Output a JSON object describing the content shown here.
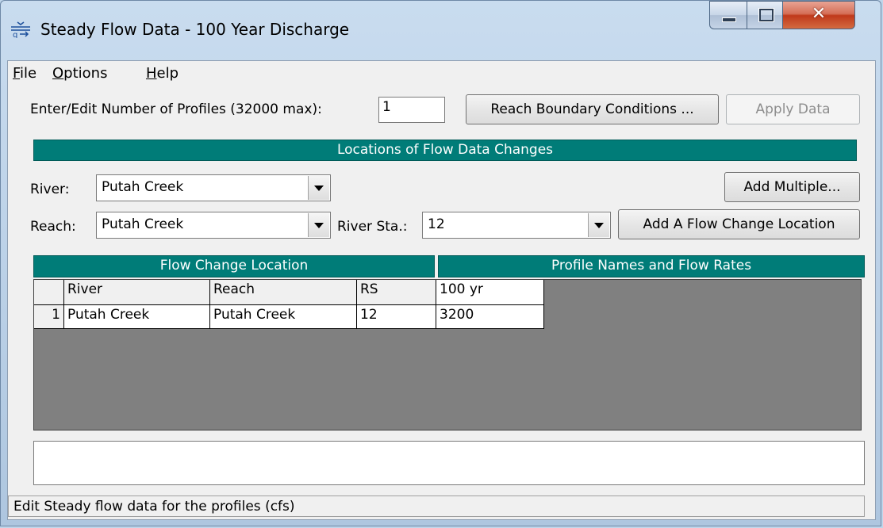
{
  "window": {
    "title": "Steady Flow Data - 100 Year Discharge"
  },
  "menu": {
    "file": "File",
    "options": "Options",
    "help": "Help"
  },
  "profiles": {
    "label": "Enter/Edit Number of Profiles (32000 max):",
    "value": "1"
  },
  "buttons": {
    "reach_boundary": "Reach Boundary Conditions ...",
    "apply_data": "Apply Data",
    "add_multiple": "Add Multiple...",
    "add_flow_change": "Add A Flow Change Location"
  },
  "locations_header": "Locations of Flow Data Changes",
  "river": {
    "label": "River:",
    "value": "Putah Creek"
  },
  "reach": {
    "label": "Reach:",
    "value": "Putah Creek"
  },
  "river_sta": {
    "label": "River Sta.:",
    "value": "12"
  },
  "table": {
    "left_header": "Flow Change Location",
    "right_header": "Profile Names and Flow Rates",
    "columns": [
      "River",
      "Reach",
      "RS",
      "100 yr"
    ],
    "rows": [
      {
        "num": "1",
        "river": "Putah Creek",
        "reach": "Putah Creek",
        "rs": "12",
        "flow": "3200"
      }
    ]
  },
  "status_text": "Edit Steady flow data for the profiles (cfs)",
  "colors": {
    "teal_header": "#007c78",
    "grid_bg": "#808080"
  }
}
